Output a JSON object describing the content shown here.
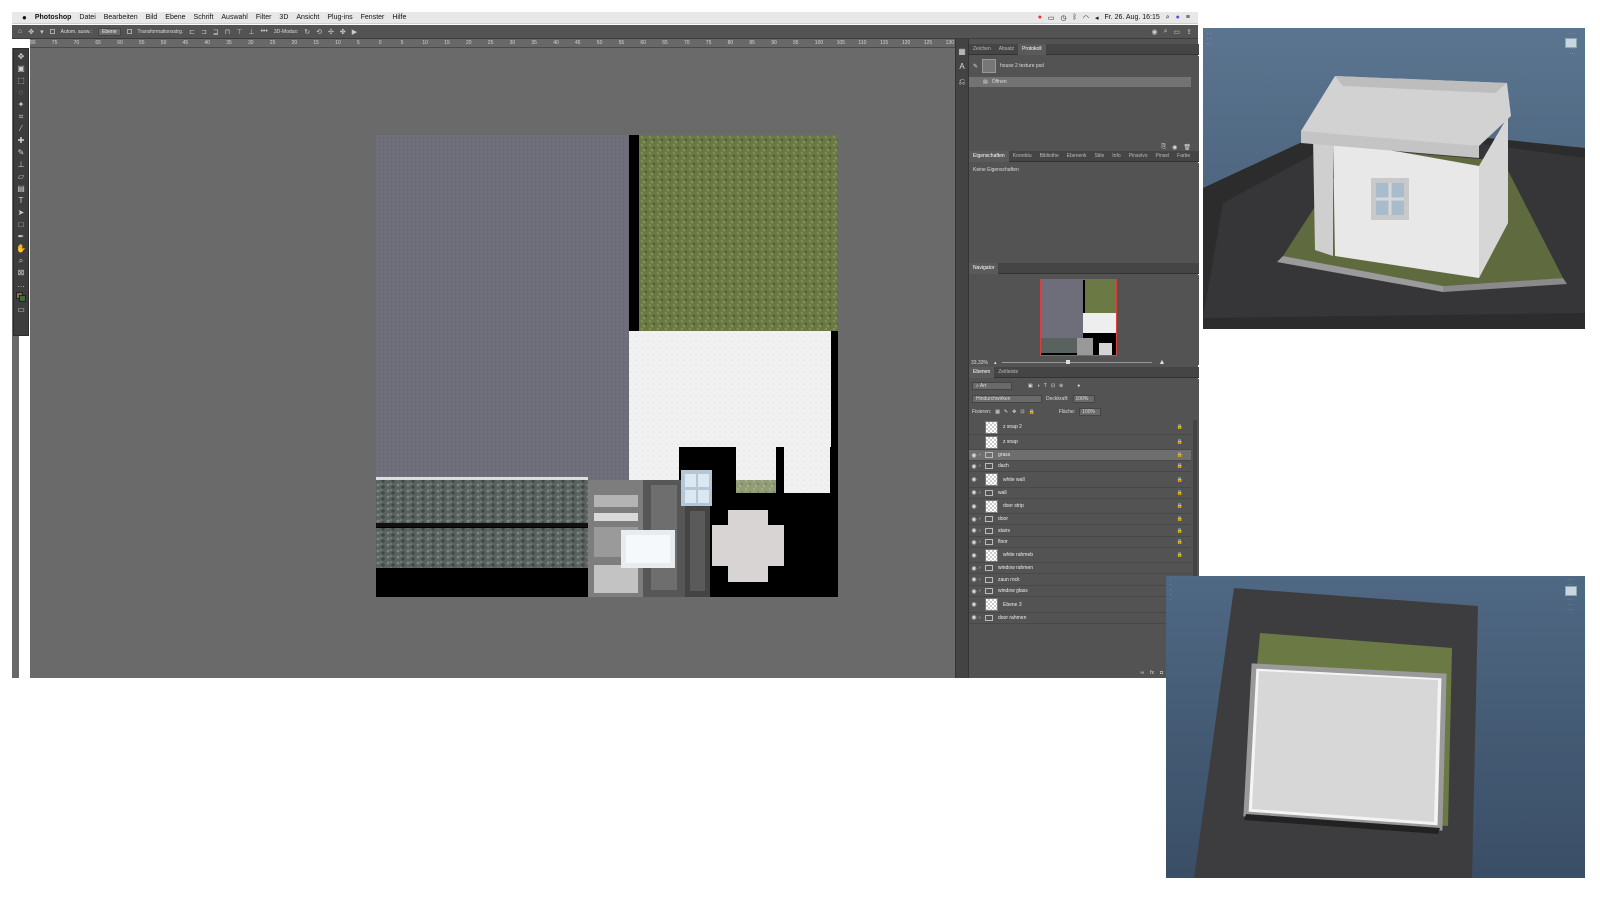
{
  "menubar": {
    "apple": "",
    "app": "Photoshop",
    "items": [
      "Datei",
      "Bearbeiten",
      "Bild",
      "Ebene",
      "Schrift",
      "Auswahl",
      "Filter",
      "3D",
      "Ansicht",
      "Plug-ins",
      "Fenster",
      "Hilfe"
    ],
    "datetime": "Fr. 26. Aug. 16:15"
  },
  "options": {
    "auto_select": "Autom. ausw.:",
    "target": "Ebene",
    "transform": "Transformationsstrg.",
    "mode3d": "3D-Modus:"
  },
  "ruler": {
    "ticks": [
      "80",
      "75",
      "70",
      "65",
      "60",
      "55",
      "50",
      "45",
      "40",
      "35",
      "30",
      "25",
      "20",
      "15",
      "10",
      "5",
      "0",
      "5",
      "10",
      "15",
      "20",
      "25",
      "30",
      "35",
      "40",
      "45",
      "50",
      "55",
      "60",
      "65",
      "70",
      "75",
      "80",
      "85",
      "90",
      "95",
      "100",
      "105",
      "110",
      "115",
      "120",
      "125",
      "130"
    ]
  },
  "panels": {
    "history_tabs": [
      "Zeichen",
      "Absatz",
      "Protokoll"
    ],
    "history_doc": "house 2 texture psd",
    "history_open": "Öffnen",
    "props_tabs": [
      "Eigenschaften",
      "Korrektu",
      "Bibliothe",
      "Ebenenk",
      "Stile",
      "Info",
      "Pinselvo",
      "Pinsel",
      "Farbe"
    ],
    "props_empty": "Keine Eigenschaften",
    "navigator_tab": "Navigator",
    "zoom": "33,33%",
    "layers_tabs": [
      "Ebenen",
      "Zeitleiste"
    ],
    "filter_kind": "Art",
    "blend_mode": "Hindurchwirken",
    "opacity_label": "Deckkraft:",
    "opacity_value": "100%",
    "lock_label": "Fixieren:",
    "fill_label": "Fläche:",
    "fill_value": "100%"
  },
  "layers": [
    {
      "name": "z snap 2",
      "kind": "layer"
    },
    {
      "name": "z snap",
      "kind": "layer"
    },
    {
      "name": "grass",
      "kind": "group"
    },
    {
      "name": "dach",
      "kind": "group"
    },
    {
      "name": "white wall",
      "kind": "layer"
    },
    {
      "name": "wall",
      "kind": "group"
    },
    {
      "name": "door strip",
      "kind": "layer"
    },
    {
      "name": "door",
      "kind": "group"
    },
    {
      "name": "stairs",
      "kind": "group"
    },
    {
      "name": "floor",
      "kind": "group"
    },
    {
      "name": "white rahmeb",
      "kind": "layer"
    },
    {
      "name": "window rahmen",
      "kind": "group"
    },
    {
      "name": "zaun rock",
      "kind": "group"
    },
    {
      "name": "window glass",
      "kind": "group"
    },
    {
      "name": "Ebene 3",
      "kind": "layer"
    },
    {
      "name": "door rahmen",
      "kind": "group"
    }
  ],
  "colors": {
    "menubar": "#e8e8e8",
    "ps_panel": "#535353",
    "ps_canvas": "#6a6a6a",
    "asphalt": "#6d6e7a",
    "grass": "#6b7a44",
    "wall_white": "#f1f1f1",
    "viewport_sky": "#5b7590"
  },
  "icons": {
    "tool_icons": [
      "move-icon",
      "artboard-icon",
      "marquee-icon",
      "lasso-icon",
      "magic-wand-icon",
      "crop-icon",
      "eyedropper-icon",
      "healing-icon",
      "brush-icon",
      "stamp-icon",
      "eraser-icon",
      "gradient-icon",
      "blur-icon",
      "dodge-icon",
      "pen-icon",
      "type-icon",
      "path-select-icon",
      "rectangle-icon",
      "hand-icon",
      "zoom-icon",
      "more-icon"
    ]
  }
}
